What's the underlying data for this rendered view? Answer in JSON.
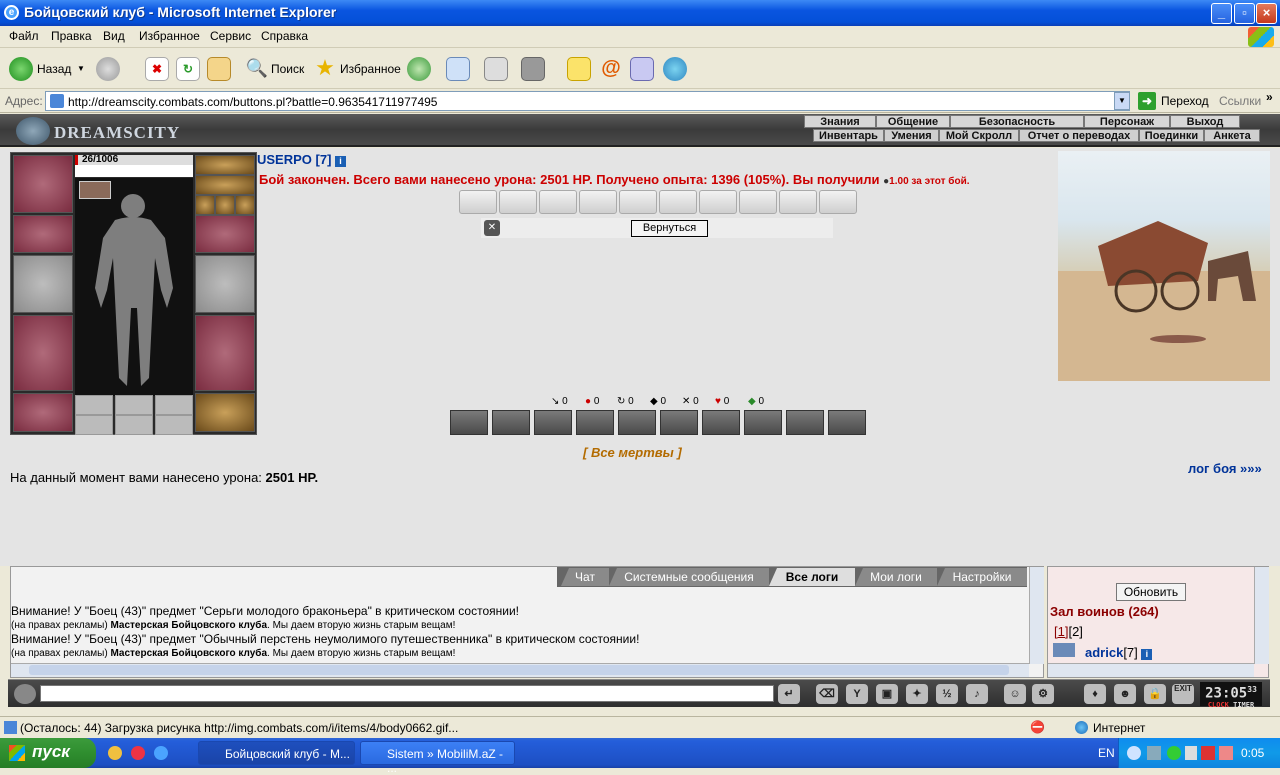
{
  "window": {
    "title": "Бойцовский клуб - Microsoft Internet Explorer"
  },
  "menu": [
    "Файл",
    "Правка",
    "Вид",
    "Избранное",
    "Сервис",
    "Справка"
  ],
  "toolbar": {
    "back": "Назад",
    "search": "Поиск",
    "favorites": "Избранное"
  },
  "address": {
    "label": "Адрес:",
    "url": "http://dreamscity.combats.com/buttons.pl?battle=0.963541711977495",
    "go": "Переход",
    "links": "Ссылки"
  },
  "game": {
    "logo": "DREAMSCITY",
    "nav_top": [
      "Знания",
      "Общение",
      "Безопасность",
      "Персонаж",
      "Выход"
    ],
    "nav_bottom": [
      "Инвентарь",
      "Умения",
      "Мой Скролл",
      "Отчет о переводах",
      "Поединки",
      "Анкета"
    ]
  },
  "character": {
    "hp": "26/1006",
    "hp_fraction": 0.026,
    "name": "USERPO [7]"
  },
  "battle": {
    "result": "Бой закончен. Всего вами нанесено урона: 2501 HP. Получено опыта: 1396 (105%). Вы получили",
    "reward": "1.00 за этот бой.",
    "back_button": "Вернуться",
    "stats": [
      "0",
      "0",
      "0",
      "0",
      "0",
      "0",
      "0"
    ],
    "all_dead": "[ Все мертвы ]",
    "damage_prefix": "На данный момент вами нанесено урона:",
    "damage_value": "2501 HP.",
    "log_link": "лог боя »»»"
  },
  "chat": {
    "tabs": [
      "Чат",
      "Системные сообщения",
      "Все логи",
      "Мои логи",
      "Настройки"
    ],
    "active_tab": "Все логи",
    "messages": [
      {
        "text": "Внимание! У \"Боец (43)\" предмет \"Серьги молодого браконьера\" в критическом состоянии!",
        "ad_prefix": "(на правах рекламы)",
        "ad_bold": "Мастерская Бойцовского клуба",
        "ad_suffix": ". Мы даем вторую жизнь старым вещам!"
      },
      {
        "text": "Внимание! У \"Боец (43)\" предмет \"Обычный перстень неумолимого путешественника\" в критическом состоянии!",
        "ad_prefix": "(на правах рекламы)",
        "ad_bold": "Мастерская Бойцовского клуба",
        "ad_suffix": ". Мы даем вторую жизнь старым вещам!"
      }
    ]
  },
  "side": {
    "refresh": "Обновить",
    "room": "Зал воинов (264)",
    "pages": [
      "[1]",
      "[2]"
    ],
    "player": "adrick",
    "player_level": "[7]"
  },
  "gamebar": {
    "time": "23:05",
    "seconds": "33",
    "clock_label": "CLOCK",
    "timer_label": "TIMER",
    "exit": "EXIT",
    "hud": "HUD"
  },
  "status": {
    "text": "(Осталось: 44) Загрузка рисунка http://img.combats.com/i/items/4/body0662.gif...",
    "zone": "Интернет"
  },
  "taskbar": {
    "start": "пуск",
    "tasks": [
      "Бойцовский клуб - M...",
      "Sistem » MobiliM.aZ - ..."
    ],
    "lang": "EN",
    "time": "0:05"
  }
}
